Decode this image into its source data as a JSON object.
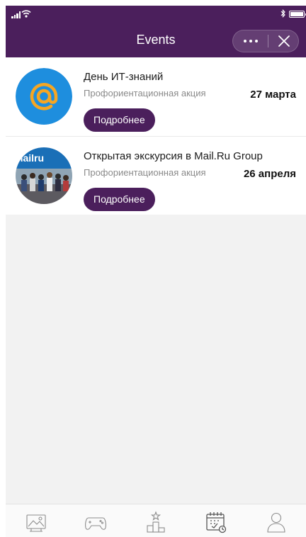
{
  "header": {
    "title": "Events",
    "more_icon": "ellipsis-icon",
    "close_icon": "close-icon",
    "background_color": "#4b1f5c"
  },
  "status_bar": {
    "icons": [
      "signal-icon",
      "wifi-icon",
      "bluetooth-icon",
      "battery-icon"
    ]
  },
  "events": [
    {
      "title": "День ИТ-знаний",
      "subtitle": "Профориентационная акция",
      "date": "27 марта",
      "button_label": "Подробнее",
      "image": "mail-at-logo"
    },
    {
      "title": "Открытая экскурсия в Mail.Ru Group",
      "subtitle": "Профориентационная акция",
      "date": "26 апреля",
      "button_label": "Подробнее",
      "image": "group-photo",
      "image_text": "mailru"
    }
  ],
  "tabbar": {
    "items": [
      "gallery-icon",
      "gamepad-icon",
      "podium-icon",
      "calendar-icon",
      "profile-icon"
    ],
    "active": "calendar-icon"
  }
}
